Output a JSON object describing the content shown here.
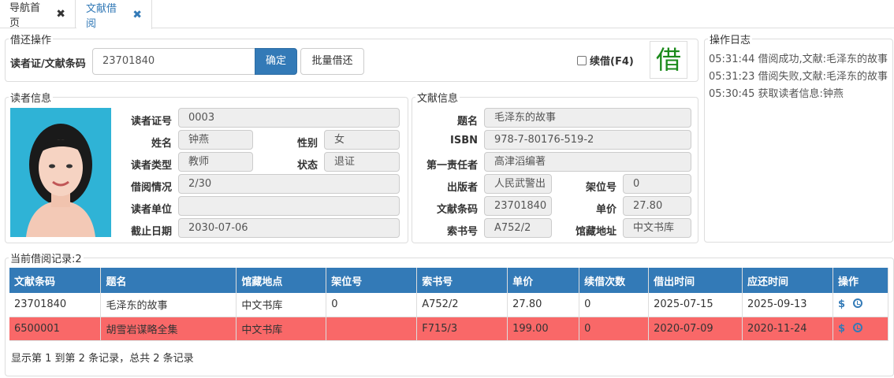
{
  "tabs": [
    {
      "label": "导航首页"
    },
    {
      "label": "文献借阅"
    }
  ],
  "borrow": {
    "legend": "借还操作",
    "barcode_label": "读者证/文献条码",
    "barcode_value": "23701840",
    "confirm_label": "确定",
    "batch_label": "批量借还",
    "renew_label": "续借(F4)",
    "mode_char": "借"
  },
  "reader": {
    "legend": "读者信息",
    "card_no_label": "读者证号",
    "card_no": "0003",
    "name_label": "姓名",
    "name": "钟燕",
    "gender_label": "性别",
    "gender": "女",
    "type_label": "读者类型",
    "type": "教师",
    "status_label": "状态",
    "status": "退证",
    "borrow_label": "借阅情况",
    "borrow": "2/30",
    "unit_label": "读者单位",
    "unit": "",
    "expire_label": "截止日期",
    "expire": "2030-07-06"
  },
  "doc": {
    "legend": "文献信息",
    "title_label": "题名",
    "title": "毛泽东的故事",
    "isbn_label": "ISBN",
    "isbn": "978-7-80176-519-2",
    "author_label": "第一责任者",
    "author": "高津滔编著",
    "publisher_label": "出版者",
    "publisher": "人民武警出",
    "shelf_label": "架位号",
    "shelf": "0",
    "barcode_label": "文献条码",
    "barcode": "23701840",
    "price_label": "单价",
    "price": "27.80",
    "callno_label": "索书号",
    "callno": "A752/2",
    "location_label": "馆藏地址",
    "location": "中文书库"
  },
  "log": {
    "legend": "操作日志",
    "lines": [
      "05:31:44 借阅成功,文献:毛泽东的故事",
      "05:31:23 借阅失败,文献:毛泽东的故事",
      "05:30:45 获取读者信息:钟燕"
    ]
  },
  "records": {
    "legend": "当前借阅记录:2",
    "columns": [
      "文献条码",
      "题名",
      "馆藏地点",
      "架位号",
      "索书号",
      "单价",
      "续借次数",
      "借出时间",
      "应还时间",
      "操作"
    ],
    "rows": [
      [
        "23701840",
        "毛泽东的故事",
        "中文书库",
        "0",
        "A752/2",
        "27.80",
        "0",
        "2025-07-15",
        "2025-09-13"
      ],
      [
        "6500001",
        "胡雪岩谋略全集",
        "中文书库",
        "",
        "F715/3",
        "199.00",
        "0",
        "2020-07-09",
        "2020-11-24"
      ]
    ],
    "op_icons": [
      "dollar-icon",
      "clock-icon"
    ],
    "footer": "显示第 1 到第 2 条记录，总共 2 条记录"
  }
}
